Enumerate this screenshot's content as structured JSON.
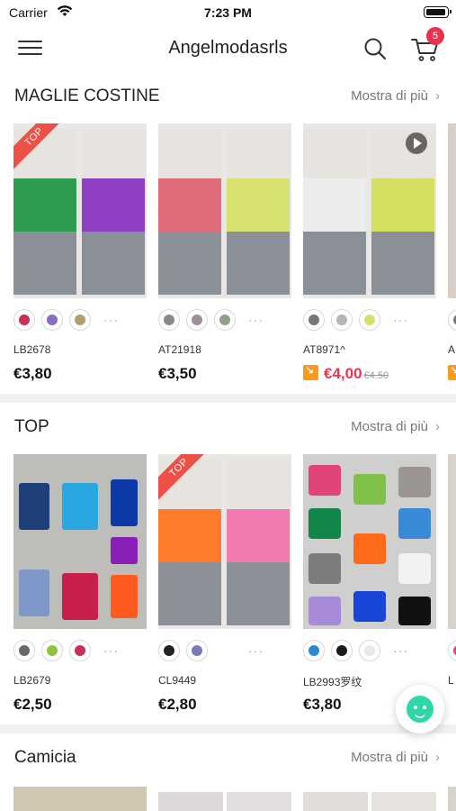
{
  "status_bar": {
    "carrier": "Carrier",
    "time": "7:23 PM"
  },
  "header": {
    "title": "Angelmodasrls",
    "cart_count": "5"
  },
  "sections": [
    {
      "title": "MAGLIE COSTINE",
      "see_more": "Mostra di più",
      "products": [
        {
          "sku": "LB2678",
          "price": "€3,80",
          "badge": "TOP",
          "swatch_colors": [
            "#c8305a",
            "#8a6cc0",
            "#b0a070"
          ],
          "image_colors": [
            "#2d9c4f",
            "#8e3fc4"
          ]
        },
        {
          "sku": "AT21918",
          "price": "€3,50",
          "swatch_colors": [
            "#8a8a8a",
            "#9a8f9a",
            "#8fa088"
          ],
          "image_colors": [
            "#e06a78",
            "#d8e070"
          ]
        },
        {
          "sku": "AT8971^",
          "price": "€4,00",
          "old_price": "€4.50",
          "sale": true,
          "swatch_colors": [
            "#777777",
            "#b5b5b5",
            "#d6e070"
          ],
          "image_colors": [
            "#ececec",
            "#d4df62"
          ]
        }
      ],
      "partial_product": {
        "sku": "A"
      }
    },
    {
      "title": "TOP",
      "see_more": "Mostra di più",
      "products": [
        {
          "sku": "LB2679",
          "price": "€2,50",
          "swatch_colors": [
            "#6a6a6a",
            "#8fc43e",
            "#c8305a"
          ],
          "image_colors": [
            "#1f3f7a",
            "#2aa7e0"
          ]
        },
        {
          "sku": "CL9449",
          "price": "€2,80",
          "badge": "TOP",
          "swatch_colors": [
            "#222222",
            "#7a7ab8"
          ],
          "image_colors": [
            "#ff7a2a",
            "#f07ab0"
          ]
        },
        {
          "sku": "LB2993罗纹",
          "price": "€3,80",
          "swatch_colors": [
            "#2a8ad0",
            "#1a1a1a",
            "#e8e8e8"
          ],
          "image_colors": [
            "#e0447a",
            "#7fc04a"
          ]
        }
      ],
      "partial_product": {
        "sku": "L"
      }
    },
    {
      "title": "Camicia",
      "see_more": "Mostra di più",
      "products": []
    }
  ],
  "colors": {
    "accent": "#e8334f",
    "sale": "#f79a1f",
    "chat": "#2fd6a8"
  }
}
